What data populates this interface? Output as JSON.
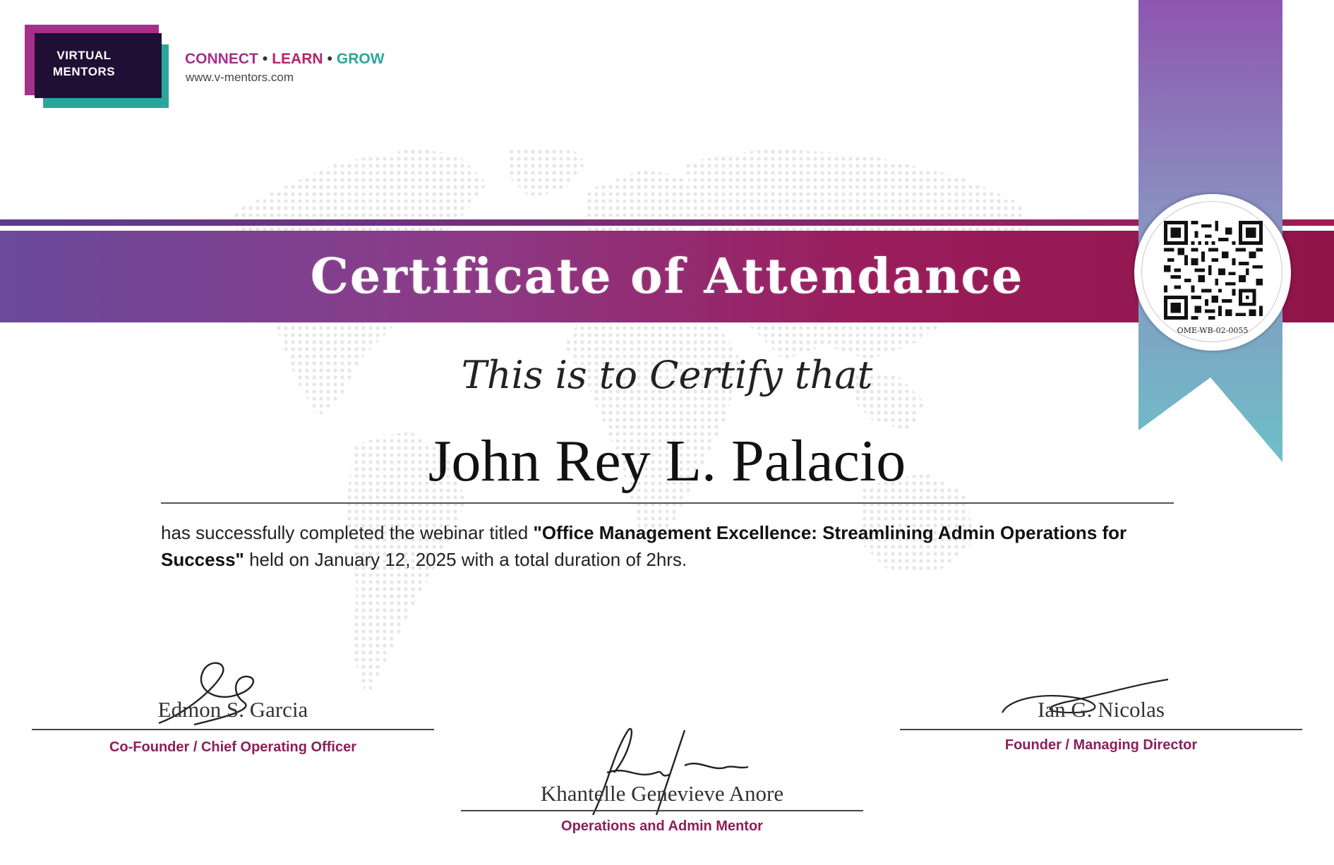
{
  "logo": {
    "line1": "VIRTUAL",
    "line2": "MENTORS"
  },
  "tagline": {
    "word1": "CONNECT",
    "word2": "LEARN",
    "word3": "GROW",
    "separator": "•"
  },
  "website": "www.v-mentors.com",
  "title": "Certificate of Attendance",
  "seal": {
    "code": "OME-WB-02-0055"
  },
  "certify_text": "This is to Certify that",
  "recipient": "John Rey L. Palacio",
  "body": {
    "prefix": "has successfully completed the webinar titled ",
    "webinar_title": "\"Office Management Excellence: Streamlining Admin Operations for Success\"",
    "suffix": " held on January 12, 2025 with a total duration of 2hrs."
  },
  "signatories": [
    {
      "name": "Edmon S. Garcia",
      "role": "Co-Founder / Chief Operating Officer"
    },
    {
      "name": "Khantelle Genevieve Anore",
      "role": "Operations and Admin Mentor"
    },
    {
      "name": "Ian G. Nicolas",
      "role": "Founder / Managing Director"
    }
  ],
  "colors": {
    "purple": "#6b4a9c",
    "magenta": "#9a1d5c",
    "teal": "#2aa79b",
    "role_text": "#8c1f5a"
  }
}
